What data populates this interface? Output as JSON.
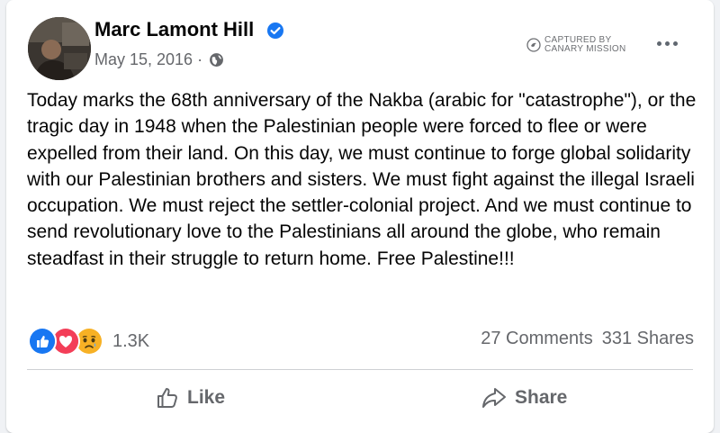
{
  "post": {
    "author": "Marc Lamont Hill",
    "date": "May 15, 2016",
    "date_separator": "·",
    "text": "Today marks the 68th anniversary of the Nakba (arabic for \"catastrophe\"), or the tragic day in 1948 when the Palestinian people were forced to flee or were expelled from their land. On this day, we must continue to forge global solidarity with our Palestinian brothers and sisters. We must fight against the illegal Israeli occupation. We must reject the settler-colonial project. And we must continue to send revolutionary love to the Palestinians all around the globe, who remain steadfast in their struggle to return home. Free Palestine!!!"
  },
  "watermark": {
    "line1": "CAPTURED BY",
    "line2": "CANARY MISSION"
  },
  "reactions": {
    "icons": [
      "like-icon",
      "love-icon",
      "sad-icon"
    ],
    "count": "1.3K"
  },
  "stats": {
    "comments": "27 Comments",
    "shares": "331 Shares"
  },
  "actions": {
    "like_label": "Like",
    "share_label": "Share"
  },
  "colors": {
    "facebook_blue": "#1877f2",
    "love_red": "#f33e58",
    "sad_yellow": "#f7b125",
    "secondary_text": "#65676b"
  }
}
